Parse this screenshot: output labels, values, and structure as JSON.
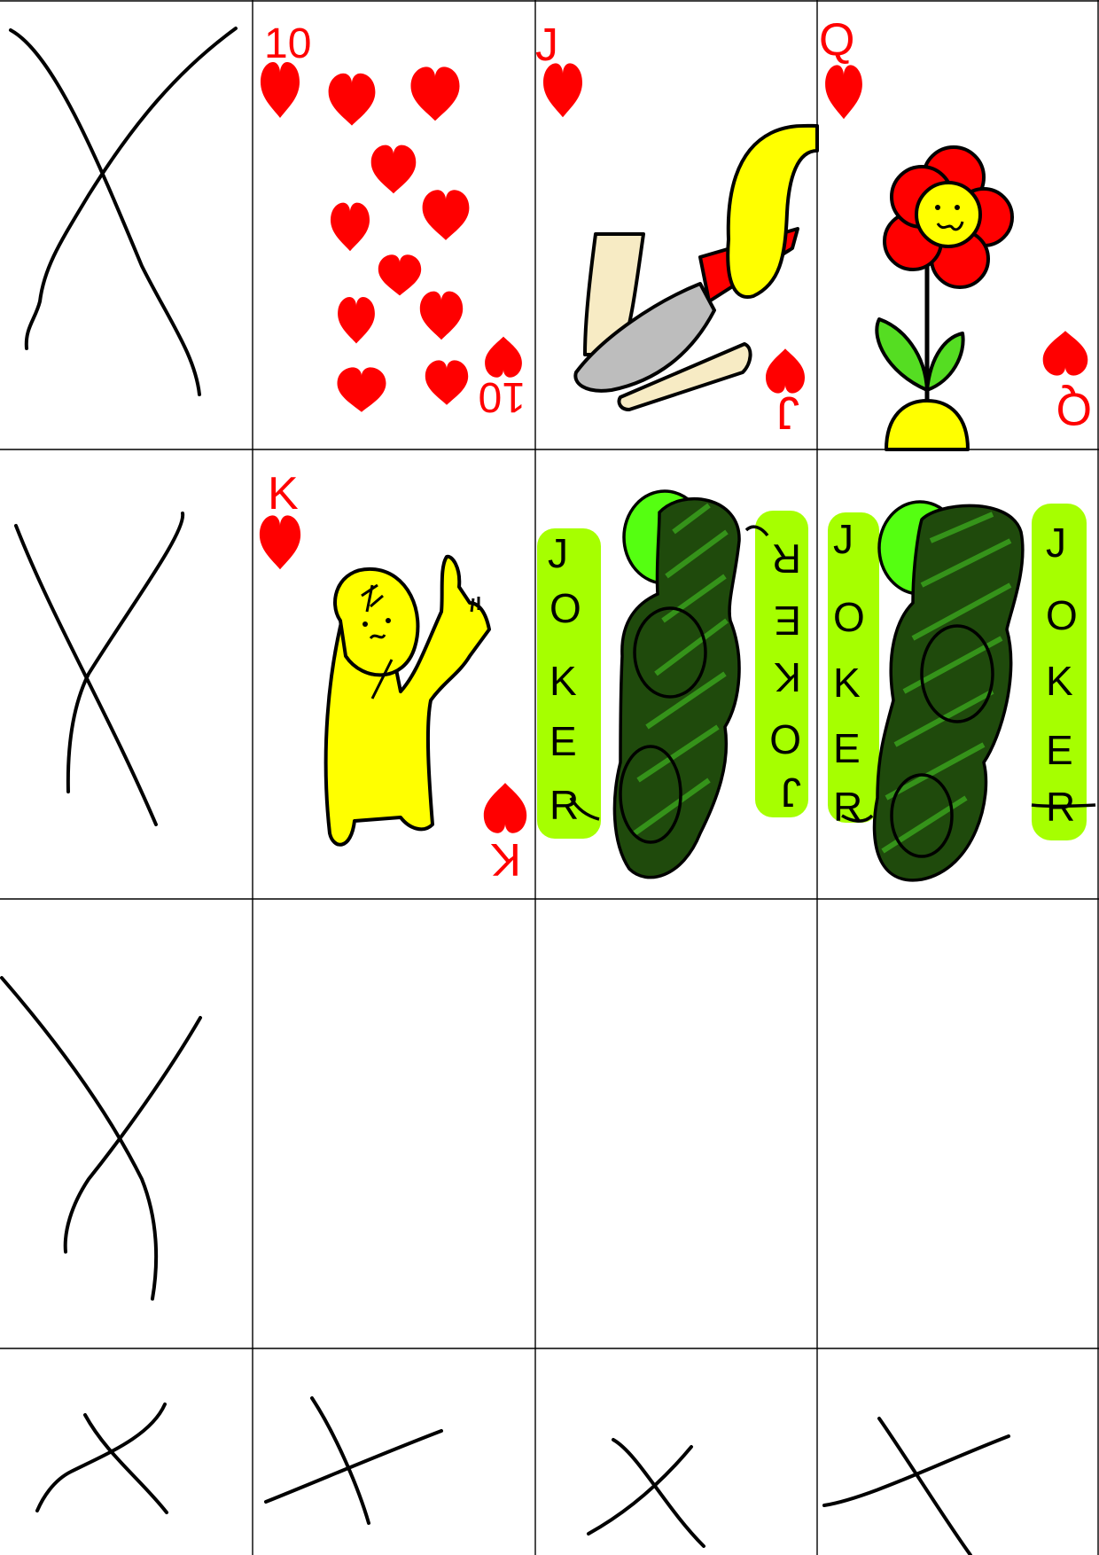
{
  "sheet": {
    "cards": {
      "ten": {
        "rank": "10",
        "suit": "hearts"
      },
      "jack": {
        "rank": "J",
        "suit": "hearts"
      },
      "queen": {
        "rank": "Q",
        "suit": "hearts"
      },
      "king": {
        "rank": "K",
        "suit": "hearts"
      },
      "joker_1": {
        "letters": [
          "J",
          "O",
          "K",
          "E",
          "R"
        ]
      },
      "joker_2": {
        "letters": [
          "J",
          "O",
          "K",
          "E",
          "R"
        ]
      }
    }
  },
  "colors": {
    "suit_red": "#ff0000",
    "ink": "#000000",
    "yellow": "#ffff00",
    "joker_lime": "#a6ff00",
    "joker_green": "#55ff22",
    "joker_dark": "#1a3a0a",
    "blade_gray": "#bdbdbd",
    "bread": "#f7ebc4"
  }
}
